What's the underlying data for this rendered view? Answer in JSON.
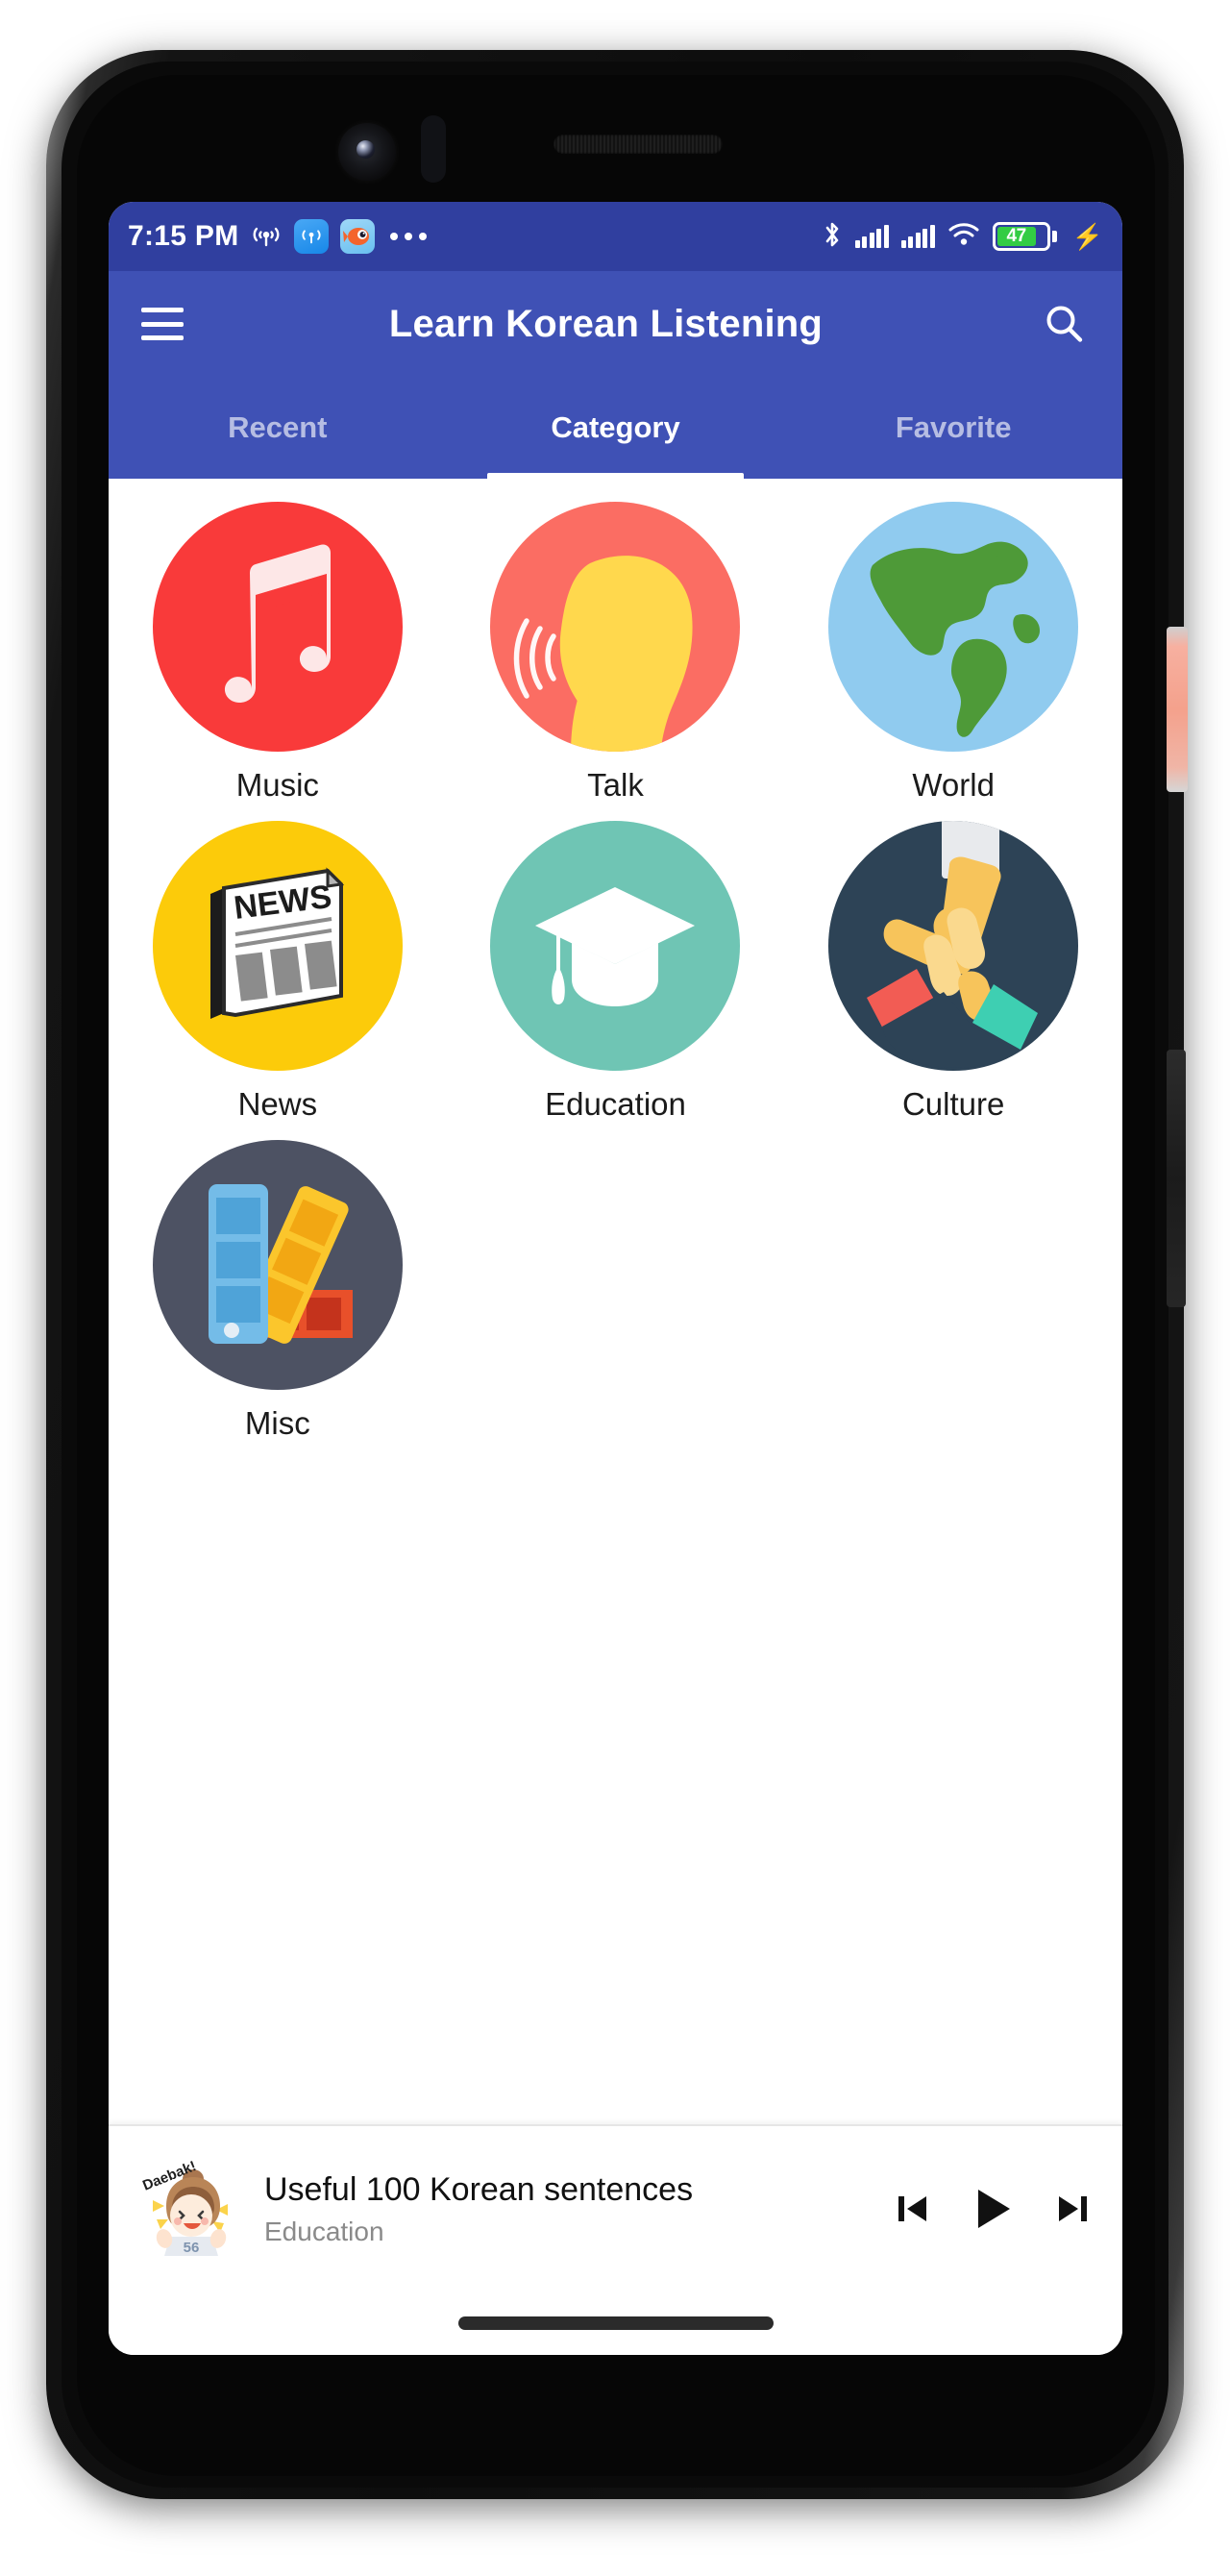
{
  "status_bar": {
    "time": "7:15 PM",
    "icons_left": [
      "cast-icon",
      "hotspot-notification-icon",
      "fish-app-notification-icon",
      "more-notifications-dots"
    ],
    "icons_right": [
      "bluetooth-icon",
      "signal-sim1-icon",
      "signal-sim2-icon",
      "wifi-icon",
      "battery-icon",
      "charging-bolt-icon"
    ],
    "battery_percent": "47",
    "background_color": "#303F9F"
  },
  "app_bar": {
    "menu_icon": "hamburger-menu-icon",
    "title": "Learn Korean Listening",
    "search_icon": "search-icon",
    "background_color": "#3F51B5"
  },
  "tabs": {
    "items": [
      {
        "label": "Recent",
        "active": false
      },
      {
        "label": "Category",
        "active": true
      },
      {
        "label": "Favorite",
        "active": false
      }
    ],
    "active_index": 1,
    "indicator_color": "#FFFFFF"
  },
  "categories": [
    {
      "label": "Music",
      "icon": "music-note-icon",
      "circle_color": "#F93A3A"
    },
    {
      "label": "Talk",
      "icon": "speaking-head-icon",
      "circle_color": "#FB6D63"
    },
    {
      "label": "World",
      "icon": "globe-icon",
      "circle_color": "#90CBEF"
    },
    {
      "label": "News",
      "icon": "newspaper-icon",
      "circle_color": "#FCCB0A"
    },
    {
      "label": "Education",
      "icon": "graduation-cap-icon",
      "circle_color": "#6FC5B4"
    },
    {
      "label": "Culture",
      "icon": "joined-hands-icon",
      "circle_color": "#2D4356"
    },
    {
      "label": "Misc",
      "icon": "color-swatches-icon",
      "circle_color": "#4D5263"
    }
  ],
  "player": {
    "thumbnail": "daebak-character-thumbnail",
    "thumbnail_caption": "Daebak!",
    "thumbnail_number": "56",
    "title": "Useful 100 Korean sentences",
    "subtitle": "Education",
    "controls": [
      {
        "name": "previous-track-button",
        "icon": "skip-previous-icon"
      },
      {
        "name": "play-button",
        "icon": "play-icon"
      },
      {
        "name": "next-track-button",
        "icon": "skip-next-icon"
      }
    ]
  },
  "system": {
    "gesture_bar": "home-gesture-pill"
  }
}
